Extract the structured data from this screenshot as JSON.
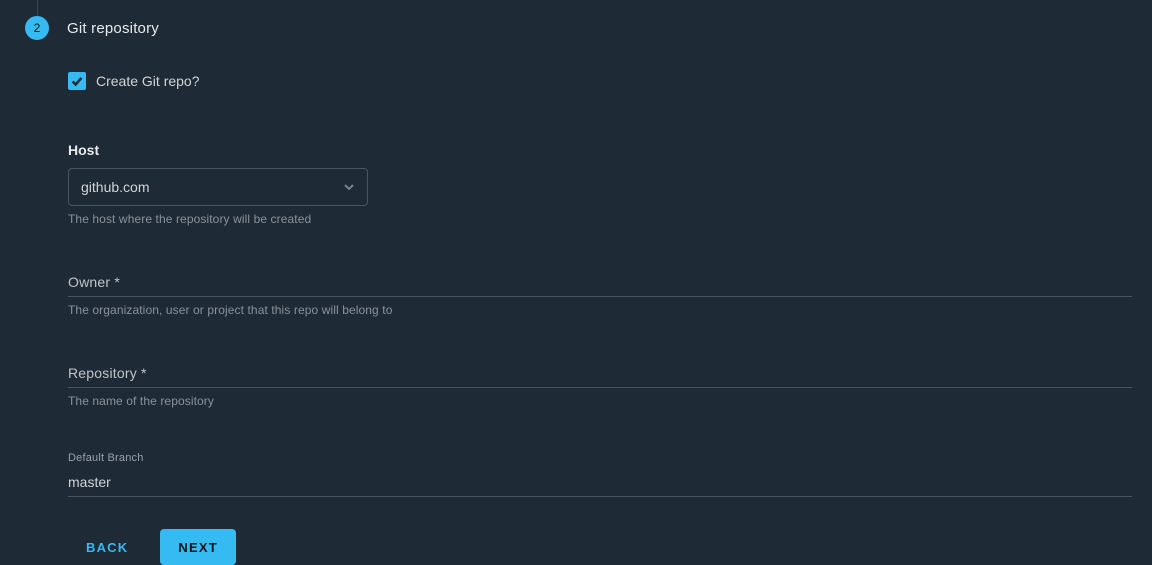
{
  "step": {
    "number": "2",
    "title": "Git repository"
  },
  "checkbox": {
    "label": "Create Git repo?"
  },
  "host": {
    "label": "Host",
    "value": "github.com",
    "helper": "The host where the repository will be created"
  },
  "owner": {
    "label": "Owner *",
    "helper": "The organization, user or project that this repo will belong to"
  },
  "repository": {
    "label": "Repository *",
    "helper": "The name of the repository"
  },
  "defaultBranch": {
    "label": "Default Branch",
    "value": "master"
  },
  "buttons": {
    "back": "BACK",
    "next": "NEXT"
  }
}
